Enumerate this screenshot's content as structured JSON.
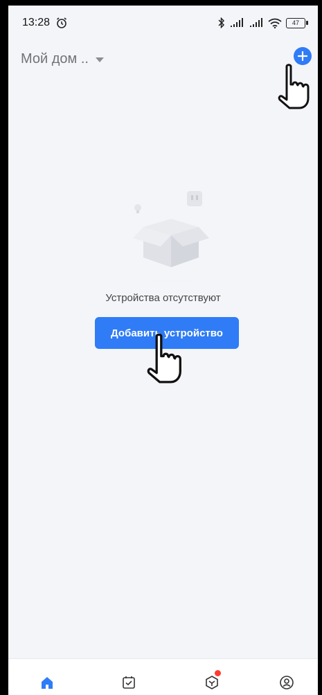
{
  "status_bar": {
    "time": "13:28",
    "battery": "47",
    "icons": [
      "alarm-icon",
      "bluetooth-icon",
      "signal-icon",
      "signal-icon",
      "wifi-icon",
      "battery-icon"
    ]
  },
  "header": {
    "home_name": "Мой дом ..",
    "add_icon": "plus-icon"
  },
  "empty_state": {
    "message": "Устройства отсутствуют",
    "button_label": "Добавить устройство"
  },
  "tab_bar": {
    "tabs": [
      {
        "icon": "home-icon",
        "active": true
      },
      {
        "icon": "scenes-icon",
        "active": false
      },
      {
        "icon": "smart-icon",
        "active": false,
        "badge": true
      },
      {
        "icon": "profile-icon",
        "active": false
      }
    ]
  },
  "colors": {
    "accent": "#2f7cf6",
    "background": "#f4f5f9",
    "badge": "#ff3b30"
  }
}
